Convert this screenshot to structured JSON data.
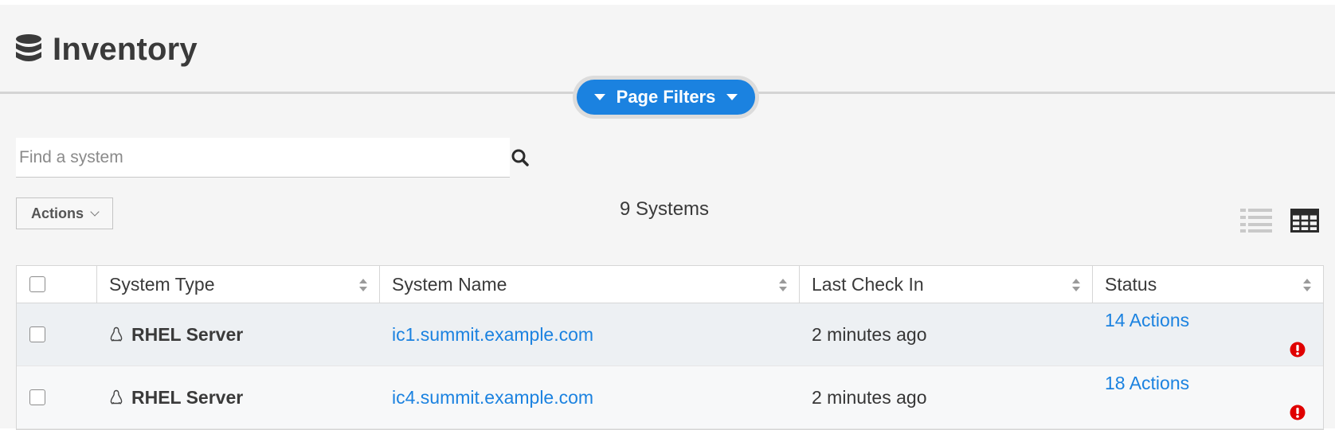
{
  "header": {
    "title": "Inventory",
    "icon": "database-icon"
  },
  "filters": {
    "label": "Page Filters",
    "color": "#1b82e0"
  },
  "search": {
    "placeholder": "Find a system",
    "value": ""
  },
  "toolbar": {
    "actions_label": "Actions",
    "count_text": "9 Systems"
  },
  "view_toggle": {
    "list_icon": "list-view-icon",
    "table_icon": "table-view-icon"
  },
  "table": {
    "columns": [
      "System Type",
      "System Name",
      "Last Check In",
      "Status"
    ],
    "rows": [
      {
        "type": "RHEL Server",
        "name": "ic1.summit.example.com",
        "last_check_in": "2 minutes ago",
        "status": "14 Actions"
      },
      {
        "type": "RHEL Server",
        "name": "ic4.summit.example.com",
        "last_check_in": "2 minutes ago",
        "status": "18 Actions"
      }
    ]
  },
  "colors": {
    "accent": "#1b82e0",
    "alert": "#e00000",
    "page_bg": "#f5f5f5"
  }
}
